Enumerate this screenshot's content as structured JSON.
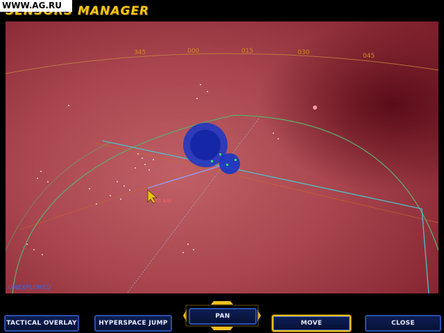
{
  "watermark": "WWW.AG.RU",
  "header": {
    "title": "SENSORS MANAGER"
  },
  "map": {
    "headings": [
      "345",
      "000",
      "015",
      "030",
      "045"
    ],
    "distance_label": "43 km",
    "status": "UNEXPLORED"
  },
  "toolbar": {
    "tactical_overlay": "TACTICAL OVERLAY",
    "hyperspace_jump": "HYPERSPACE JUMP",
    "pan": "PAN",
    "move": "MOVE",
    "close": "CLOSE"
  },
  "colors": {
    "accent_gold": "#f0c020",
    "button_border": "#2a4fb0",
    "grid_green": "#5fa86a",
    "line_cyan": "#4fc0c8",
    "heading_orange": "#d08a2a"
  }
}
